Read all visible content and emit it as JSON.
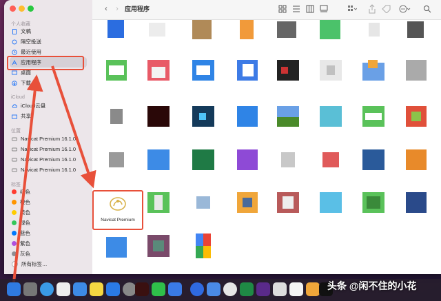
{
  "window": {
    "title": "应用程序"
  },
  "sidebar": {
    "favorites_header": "个人收藏",
    "favorites": [
      {
        "label": "文稿",
        "icon": "document-icon"
      },
      {
        "label": "隔空投送",
        "icon": "airdrop-icon"
      },
      {
        "label": "最近使用",
        "icon": "clock-icon"
      },
      {
        "label": "应用程序",
        "icon": "apps-icon",
        "selected": true
      },
      {
        "label": "桌面",
        "icon": "desktop-icon"
      },
      {
        "label": "下载",
        "icon": "download-icon"
      }
    ],
    "icloud_header": "iCloud",
    "icloud": [
      {
        "label": "iCloud云盘",
        "icon": "cloud-icon"
      },
      {
        "label": "共享",
        "icon": "shared-folder-icon"
      }
    ],
    "locations_header": "位置",
    "locations": [
      {
        "label": "Navicat Premium 16.1.0",
        "icon": "disk-icon"
      },
      {
        "label": "Navicat Premium 16.1.0",
        "icon": "disk-icon"
      },
      {
        "label": "Navicat Premium 16.1.0",
        "icon": "disk-icon"
      },
      {
        "label": "Navicat Premium 16.1.0",
        "icon": "disk-icon"
      }
    ],
    "tags_header": "标签",
    "tags": [
      {
        "label": "红色",
        "color": "#ff3b30"
      },
      {
        "label": "橙色",
        "color": "#ff9500"
      },
      {
        "label": "黄色",
        "color": "#ffcc00"
      },
      {
        "label": "绿色",
        "color": "#34c759"
      },
      {
        "label": "蓝色",
        "color": "#007aff"
      },
      {
        "label": "紫色",
        "color": "#af52de"
      },
      {
        "label": "灰色",
        "color": "#8e8e93"
      },
      {
        "label": "所有标签…",
        "color": "#cccccc"
      }
    ]
  },
  "toolbar": {
    "back": "‹",
    "forward": "›",
    "view_icons": [
      "icon-view",
      "list-view",
      "column-view",
      "gallery-view",
      "group-icon",
      "share-icon",
      "tag-icon",
      "more-icon",
      "search-icon"
    ]
  },
  "highlight_app": {
    "label": "Navicat Premium"
  },
  "dock": {
    "watermark": "头条 @闲不住的小花"
  },
  "colors": {
    "accent_red": "#e8503a",
    "selection": "#d6d0d6"
  }
}
